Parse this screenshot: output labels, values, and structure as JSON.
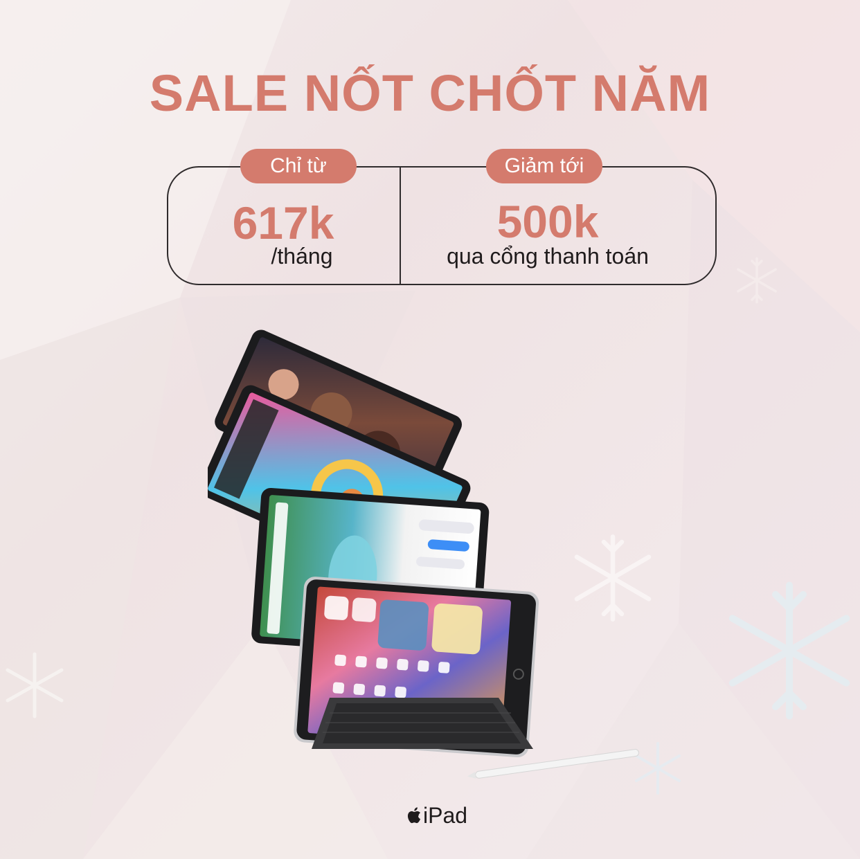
{
  "headline": "SALE NỐT CHỐT NĂM",
  "offers": [
    {
      "badge": "Chỉ từ",
      "amount": "617k",
      "note": "/tháng"
    },
    {
      "badge": "Giảm tới",
      "amount": "500k",
      "note": "qua cổng thanh toán"
    }
  ],
  "brand": {
    "icon": "apple-logo-icon",
    "label": "iPad"
  },
  "colors": {
    "accent": "#d47b6d",
    "text": "#1f1b1c",
    "outline": "#2f2b2c"
  }
}
